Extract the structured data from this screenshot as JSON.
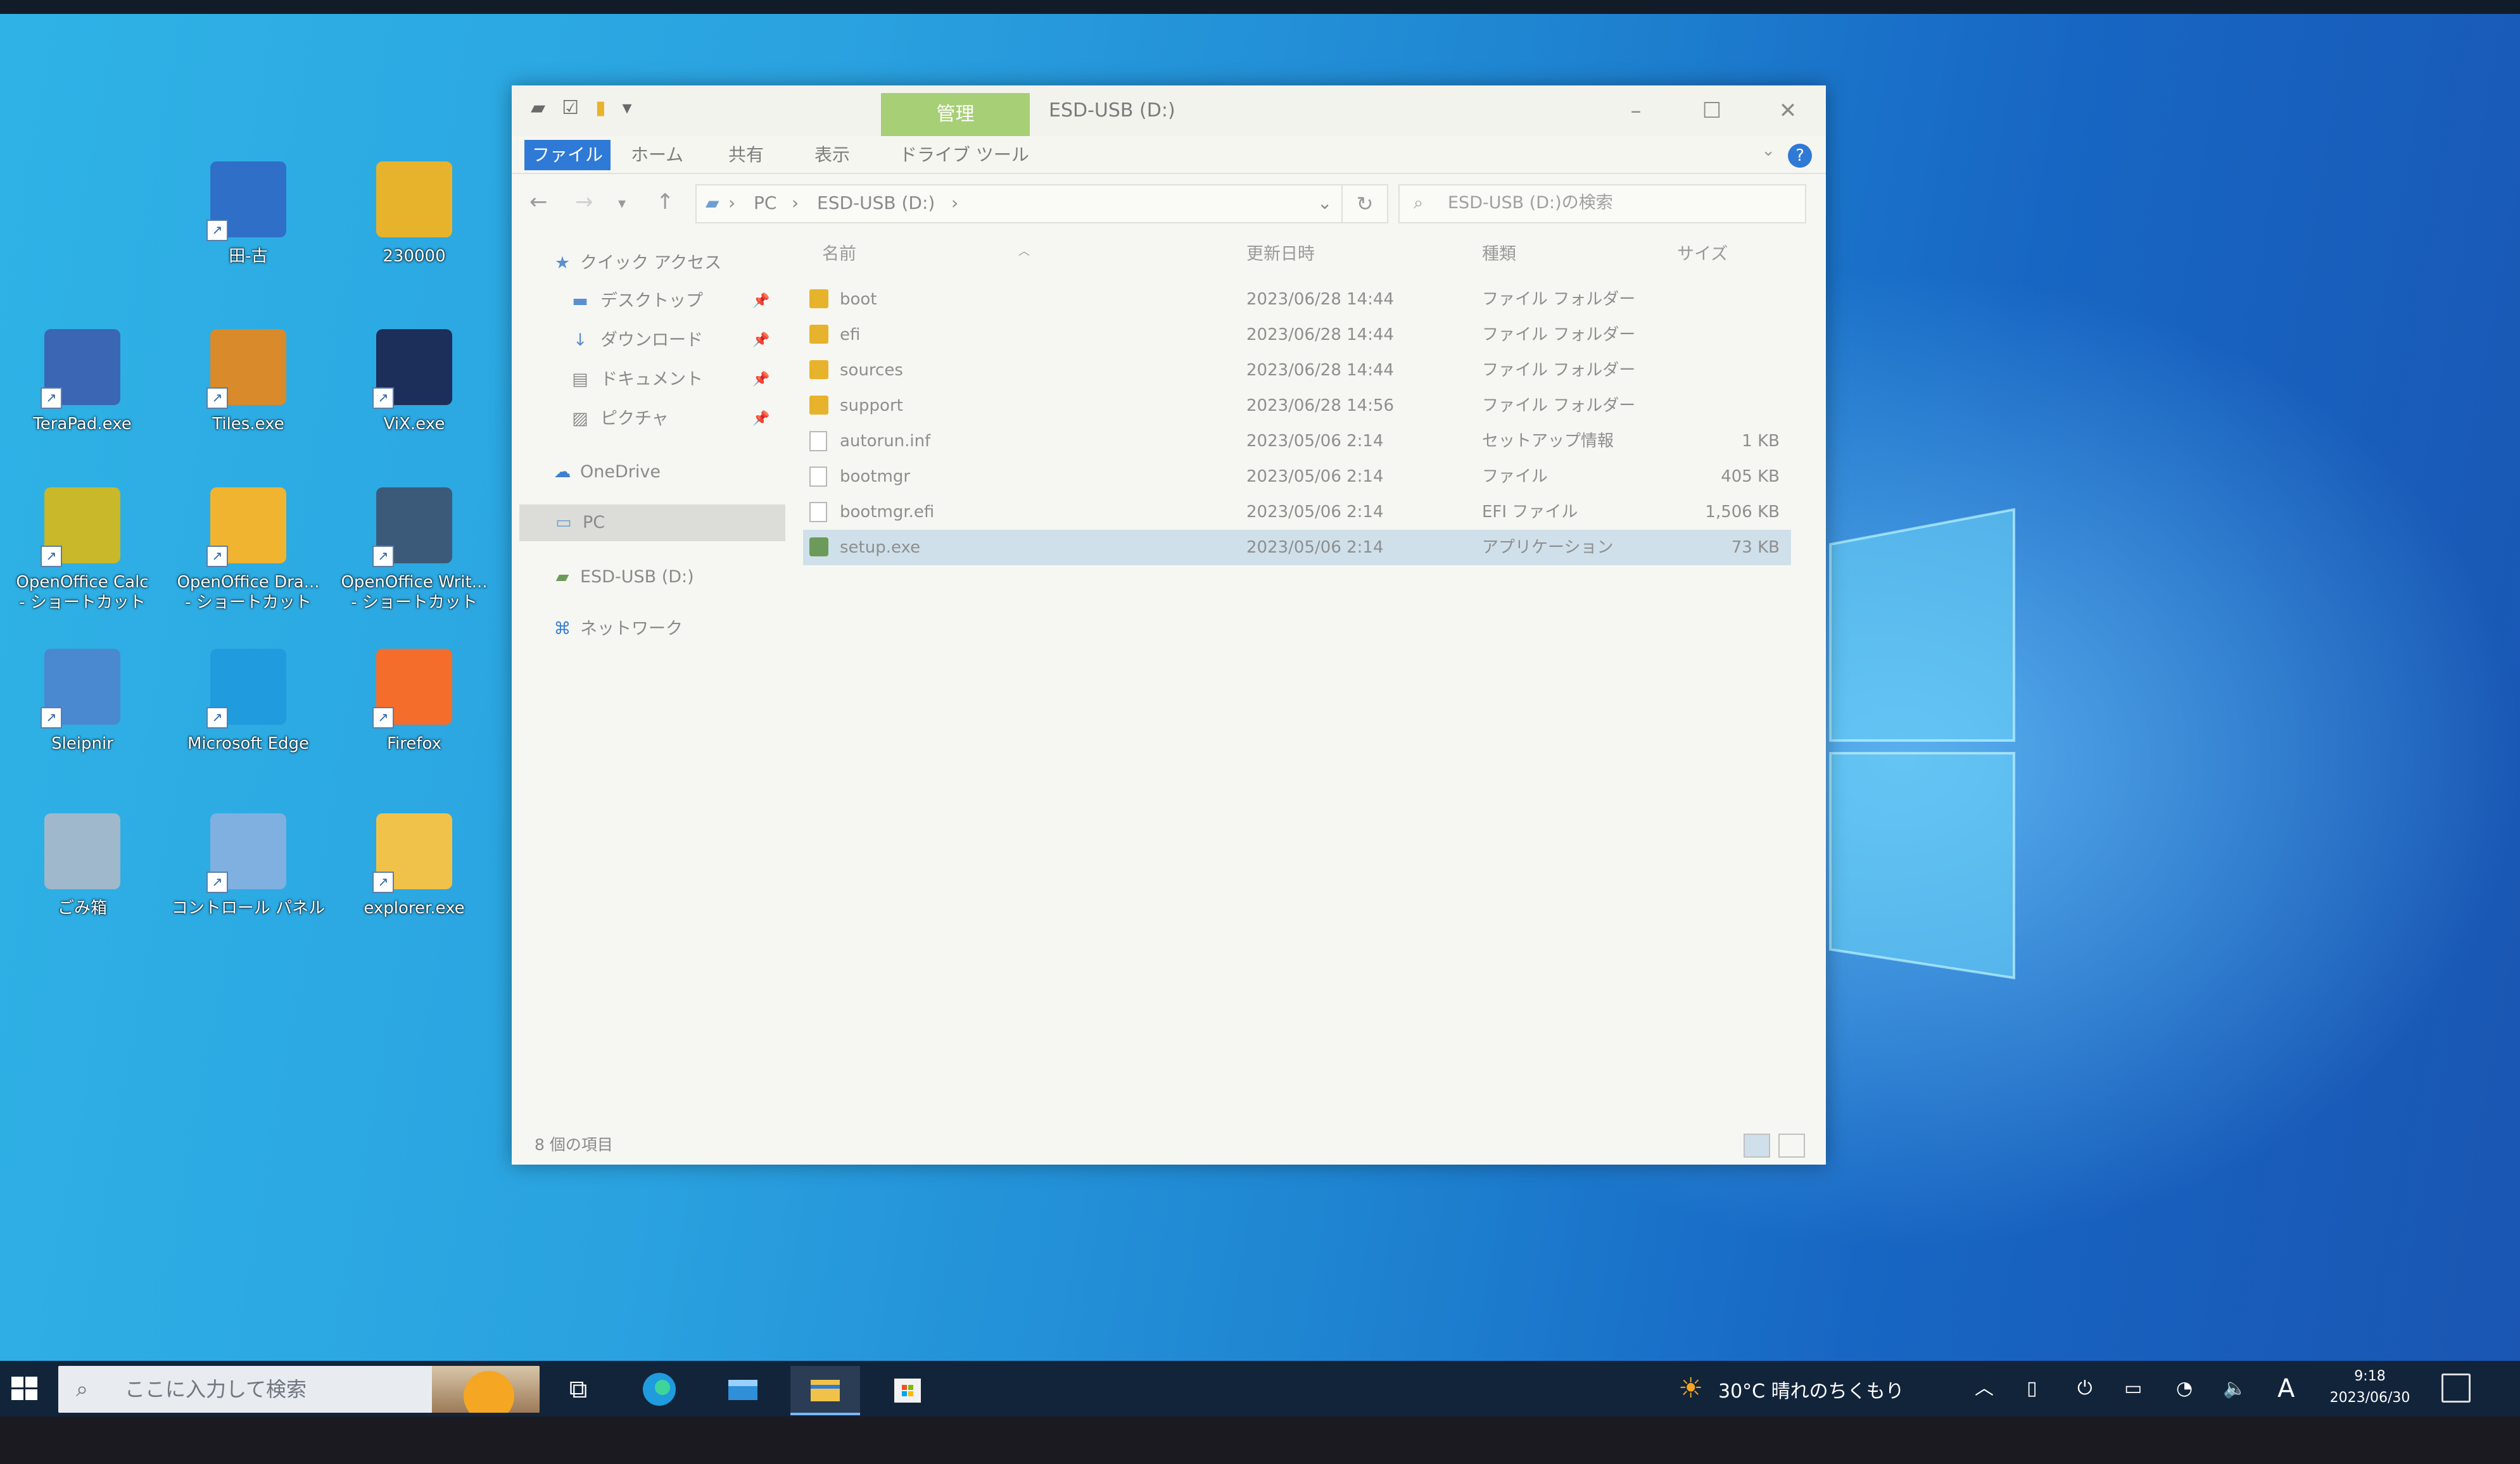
{
  "desktop": {
    "icons": [
      {
        "label": "田-古",
        "col": 1,
        "row": 0
      },
      {
        "label": "230000",
        "col": 2,
        "row": 0
      },
      {
        "label": "TeraPad.exe",
        "col": 0,
        "row": 1
      },
      {
        "label": "Tiles.exe",
        "col": 1,
        "row": 1
      },
      {
        "label": "ViX.exe",
        "col": 2,
        "row": 1
      },
      {
        "label": "OpenOffice Calc",
        "label2": "- ショートカット",
        "col": 0,
        "row": 2
      },
      {
        "label": "OpenOffice Dra...",
        "label2": "- ショートカット",
        "col": 1,
        "row": 2
      },
      {
        "label": "OpenOffice Writ...",
        "label2": "- ショートカット",
        "col": 2,
        "row": 2
      },
      {
        "label": "Sleipnir",
        "col": 0,
        "row": 3
      },
      {
        "label": "Microsoft Edge",
        "col": 1,
        "row": 3
      },
      {
        "label": "Firefox",
        "col": 2,
        "row": 3
      },
      {
        "label": "ごみ箱",
        "col": 0,
        "row": 4
      },
      {
        "label": "コントロール パネル",
        "col": 1,
        "row": 4
      },
      {
        "label": "explorer.exe",
        "col": 2,
        "row": 4
      }
    ]
  },
  "explorer": {
    "title": "ESD-USB (D:)",
    "context_tab": "管理",
    "ribbon_tabs": [
      "ファイル",
      "ホーム",
      "共有",
      "表示",
      "ドライブ ツール"
    ],
    "address": [
      "PC",
      "ESD-USB (D:)"
    ],
    "search_placeholder": "ESD-USB (D:)の検索",
    "nav": {
      "quick_access": "クイック アクセス",
      "desktop": "デスクトップ",
      "downloads": "ダウンロード",
      "documents": "ドキュメント",
      "pictures": "ピクチャ",
      "onedrive": "OneDrive",
      "pc": "PC",
      "usb": "ESD-USB (D:)",
      "network": "ネットワーク"
    },
    "columns": {
      "name": "名前",
      "modified": "更新日時",
      "type": "種類",
      "size": "サイズ"
    },
    "files": [
      {
        "name": "boot",
        "modified": "2023/06/28 14:44",
        "type": "ファイル フォルダー",
        "size": "",
        "icon": "folder-icon"
      },
      {
        "name": "efi",
        "modified": "2023/06/28 14:44",
        "type": "ファイル フォルダー",
        "size": "",
        "icon": "folder-icon"
      },
      {
        "name": "sources",
        "modified": "2023/06/28 14:44",
        "type": "ファイル フォルダー",
        "size": "",
        "icon": "folder-icon"
      },
      {
        "name": "support",
        "modified": "2023/06/28 14:56",
        "type": "ファイル フォルダー",
        "size": "",
        "icon": "folder-icon"
      },
      {
        "name": "autorun.inf",
        "modified": "2023/05/06 2:14",
        "type": "セットアップ情報",
        "size": "1 KB",
        "icon": "setup-info-icon"
      },
      {
        "name": "bootmgr",
        "modified": "2023/05/06 2:14",
        "type": "ファイル",
        "size": "405 KB",
        "icon": "file-icon"
      },
      {
        "name": "bootmgr.efi",
        "modified": "2023/05/06 2:14",
        "type": "EFI ファイル",
        "size": "1,506 KB",
        "icon": "file-icon"
      },
      {
        "name": "setup.exe",
        "modified": "2023/05/06 2:14",
        "type": "アプリケーション",
        "size": "73 KB",
        "icon": "setup-app-icon",
        "selected": true
      }
    ],
    "status": "8 個の項目"
  },
  "taskbar": {
    "search_placeholder": "ここに入力して検索",
    "weather": "30°C  晴れのちくもり",
    "ime": "A",
    "time": "9:18",
    "date": "2023/06/30"
  },
  "colors": {
    "accent": "#2f7ad6",
    "manage_tab": "#a6cf76",
    "taskbar": "#12243a"
  }
}
